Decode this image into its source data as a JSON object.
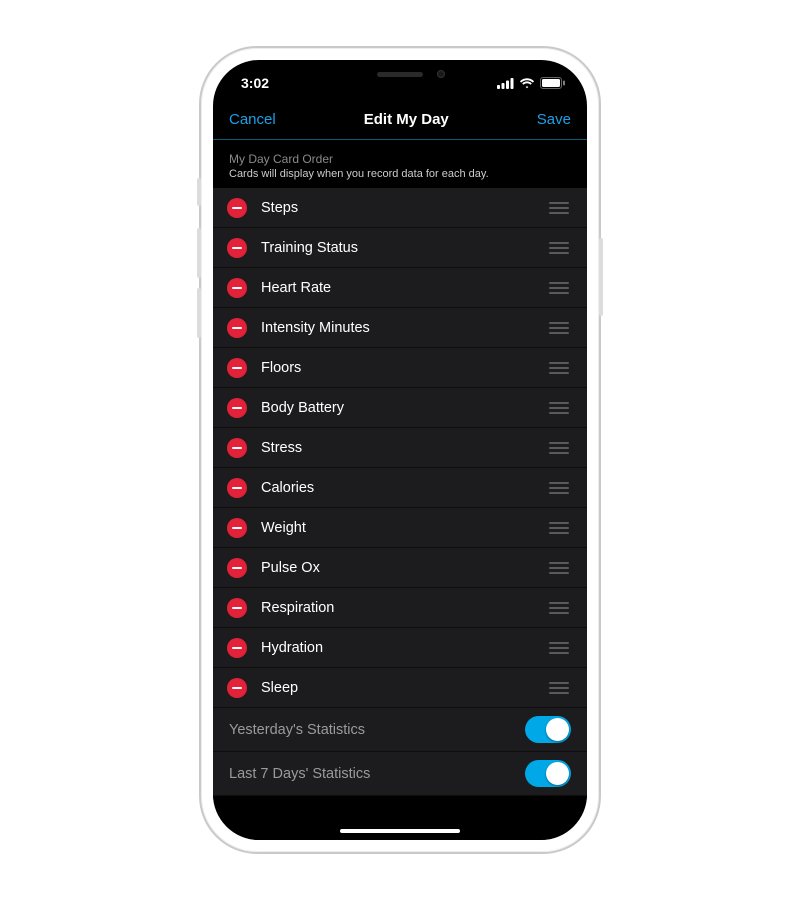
{
  "status": {
    "time": "3:02"
  },
  "nav": {
    "cancel": "Cancel",
    "title": "Edit My Day",
    "save": "Save"
  },
  "section": {
    "title": "My Day Card Order",
    "subtitle": "Cards will display when you record data for each day."
  },
  "cards": [
    {
      "label": "Steps"
    },
    {
      "label": "Training Status"
    },
    {
      "label": "Heart Rate"
    },
    {
      "label": "Intensity Minutes"
    },
    {
      "label": "Floors"
    },
    {
      "label": "Body Battery"
    },
    {
      "label": "Stress"
    },
    {
      "label": "Calories"
    },
    {
      "label": "Weight"
    },
    {
      "label": "Pulse Ox"
    },
    {
      "label": "Respiration"
    },
    {
      "label": "Hydration"
    },
    {
      "label": "Sleep"
    }
  ],
  "toggles": [
    {
      "label": "Yesterday's Statistics",
      "on": true
    },
    {
      "label": "Last 7 Days' Statistics",
      "on": true
    }
  ]
}
